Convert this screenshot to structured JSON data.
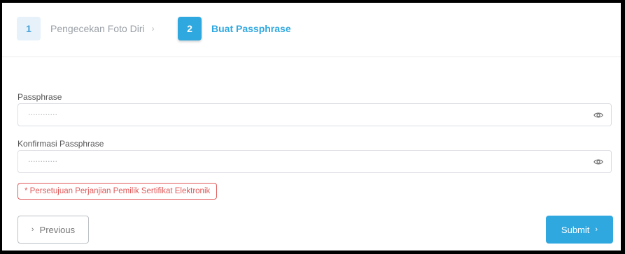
{
  "stepper": {
    "steps": [
      {
        "number": "1",
        "label": "Pengecekan Foto Diri",
        "state": "completed"
      },
      {
        "number": "2",
        "label": "Buat Passphrase",
        "state": "active"
      }
    ],
    "separator": "›"
  },
  "form": {
    "passphrase": {
      "label": "Passphrase",
      "value": "············",
      "icon": "eye-icon"
    },
    "confirm_passphrase": {
      "label": "Konfirmasi Passphrase",
      "value": "············",
      "icon": "eye-icon"
    },
    "consent_text": "* Persetujuan Perjanjian Pemilik Sertifikat Elektronik"
  },
  "buttons": {
    "previous_label": "Previous",
    "previous_icon": "›",
    "submit_label": "Submit",
    "submit_icon": "›"
  },
  "colors": {
    "accent": "#2fa8e0",
    "error": "#e05a5a",
    "muted": "#9aa0a6"
  }
}
